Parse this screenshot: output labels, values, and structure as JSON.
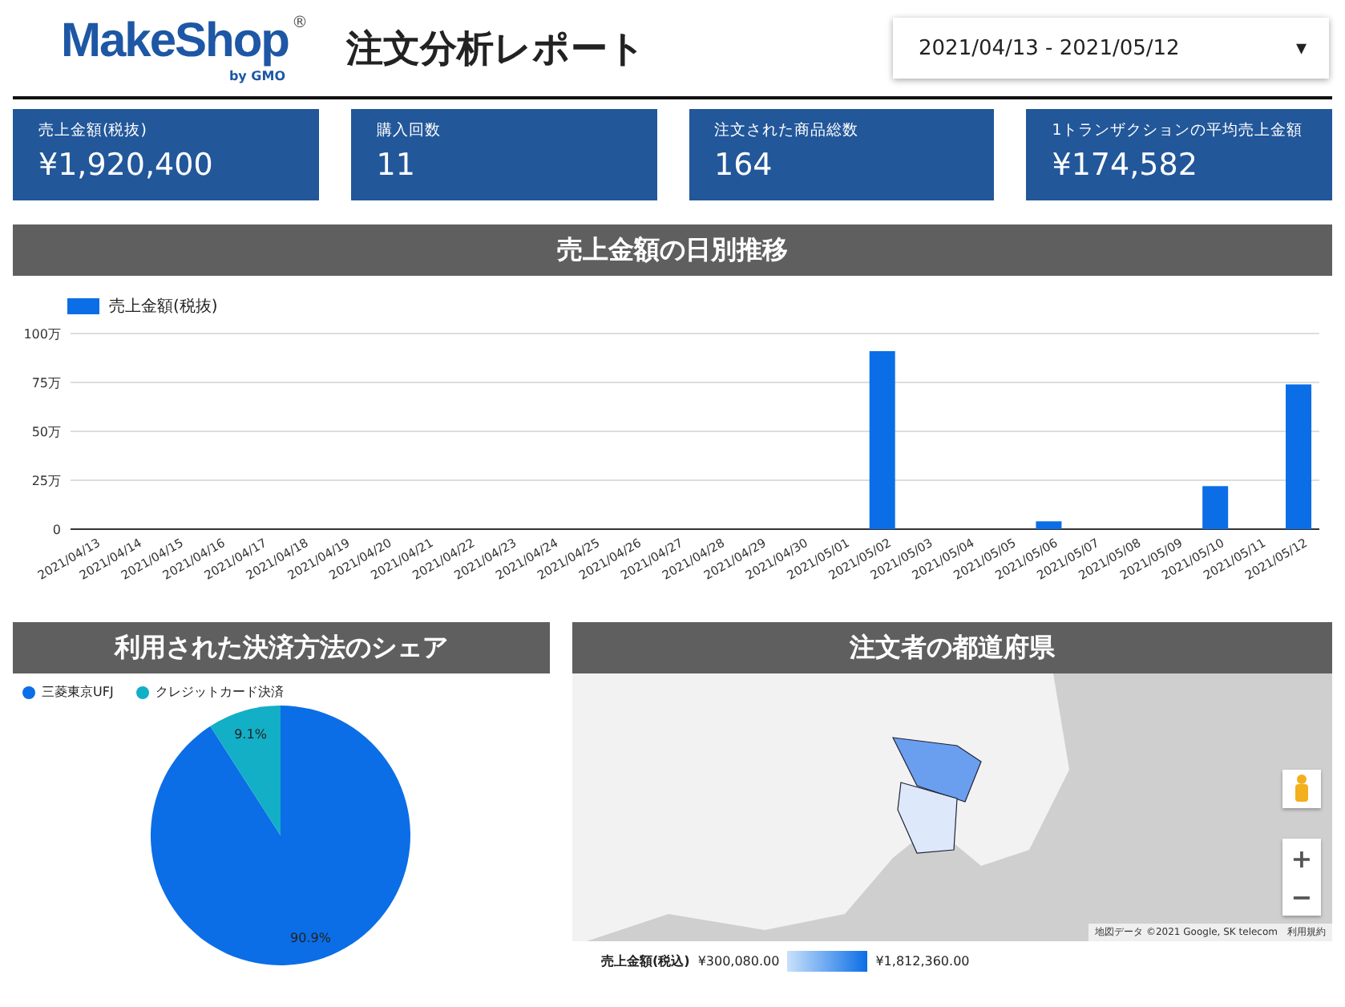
{
  "header": {
    "logo": {
      "name": "MakeShop",
      "mark": "®",
      "byline": "by GMO"
    },
    "title": "注文分析レポート",
    "date_range": {
      "value": "2021/04/13 - 2021/05/12",
      "caret": "▾"
    }
  },
  "kpis": [
    {
      "label": "売上金額(税抜)",
      "value": "¥1,920,400"
    },
    {
      "label": "購入回数",
      "value": "11"
    },
    {
      "label": "注文された商品総数",
      "value": "164"
    },
    {
      "label": "1トランザクションの平均売上金額",
      "value": "¥174,582"
    }
  ],
  "daily_sales": {
    "title": "売上金額の日別推移",
    "chart_data": {
      "type": "bar",
      "categories": [
        "2021/04/13",
        "2021/04/14",
        "2021/04/15",
        "2021/04/16",
        "2021/04/17",
        "2021/04/18",
        "2021/04/19",
        "2021/04/20",
        "2021/04/21",
        "2021/04/22",
        "2021/04/23",
        "2021/04/24",
        "2021/04/25",
        "2021/04/26",
        "2021/04/27",
        "2021/04/28",
        "2021/04/29",
        "2021/04/30",
        "2021/05/01",
        "2021/05/02",
        "2021/05/03",
        "2021/05/04",
        "2021/05/05",
        "2021/05/06",
        "2021/05/07",
        "2021/05/08",
        "2021/05/09",
        "2021/05/10",
        "2021/05/11",
        "2021/05/12"
      ],
      "series": [
        {
          "name": "売上金額(税抜)",
          "color": "#0b6ee6",
          "values": [
            0,
            0,
            0,
            0,
            0,
            0,
            0,
            0,
            0,
            0,
            0,
            0,
            0,
            0,
            0,
            0,
            0,
            0,
            0,
            91,
            0,
            0,
            0,
            4,
            0,
            0,
            0,
            22,
            0,
            74
          ]
        }
      ],
      "legend": "top",
      "grid": true,
      "ylim": [
        0,
        100
      ],
      "yticks": [
        {
          "value": 0,
          "label": "0"
        },
        {
          "value": 25,
          "label": "25万"
        },
        {
          "value": 50,
          "label": "50万"
        },
        {
          "value": 75,
          "label": "75万"
        },
        {
          "value": 100,
          "label": "100万"
        }
      ]
    }
  },
  "payment_share": {
    "title": "利用された決済方法のシェア",
    "chart_data": {
      "type": "pie",
      "categories": [
        "三菱東京UFJ",
        "クレジットカード決済"
      ],
      "values": [
        90.9,
        9.1
      ],
      "legend": "top",
      "colors": [
        "#0b6ee6",
        "#12afc6"
      ],
      "value_labels": [
        "90.9%",
        "9.1%"
      ]
    }
  },
  "prefecture_map": {
    "title": "注文者の都道府県",
    "attribution": "地図データ ©2021 Google, SK telecom",
    "terms": "利用規約",
    "zoom_in": "+",
    "zoom_out": "−",
    "legend": {
      "label": "売上金額(税込)",
      "min": "¥300,080.00",
      "max": "¥1,812,360.00"
    }
  }
}
